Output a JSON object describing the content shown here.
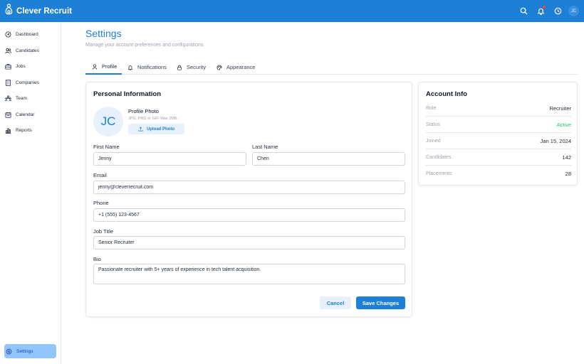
{
  "app": {
    "name": "Clever Recruit",
    "avatar_initials": "JC"
  },
  "header_icons": [
    "search-icon",
    "bell-icon",
    "clock-icon"
  ],
  "sidebar": {
    "items": [
      {
        "label": "Dashboard",
        "icon": "dashboard-icon"
      },
      {
        "label": "Candidates",
        "icon": "users-icon"
      },
      {
        "label": "Jobs",
        "icon": "briefcase-icon"
      },
      {
        "label": "Companies",
        "icon": "building-icon"
      },
      {
        "label": "Team",
        "icon": "team-icon"
      },
      {
        "label": "Calendar",
        "icon": "calendar-icon"
      },
      {
        "label": "Reports",
        "icon": "bar-chart-icon"
      }
    ],
    "settings_label": "Settings"
  },
  "page": {
    "title": "Settings",
    "subtitle": "Manage your account preferences and configurations."
  },
  "tabs": [
    {
      "label": "Profile",
      "icon": "user-icon",
      "active": true
    },
    {
      "label": "Notifications",
      "icon": "bell-icon",
      "active": false
    },
    {
      "label": "Security",
      "icon": "lock-icon",
      "active": false
    },
    {
      "label": "Appearance",
      "icon": "palette-icon",
      "active": false
    }
  ],
  "personal": {
    "title": "Personal Information",
    "avatar_initials": "JC",
    "photo_label": "Profile Photo",
    "photo_hint": "JPG, PNG or GIF. Max 2MB.",
    "upload_label": "Upload Photo",
    "first_name": {
      "label": "First Name",
      "value": "Jenny"
    },
    "last_name": {
      "label": "Last Name",
      "value": "Chen"
    },
    "email": {
      "label": "Email",
      "value": "jenny@cleverrecruit.com"
    },
    "phone": {
      "label": "Phone",
      "value": "+1 (555) 123-4567"
    },
    "job_title": {
      "label": "Job Title",
      "value": "Senior Recruiter"
    },
    "bio": {
      "label": "Bio",
      "value": "Passionate recruiter with 5+ years of experience in tech talent acquisition."
    },
    "cancel_label": "Cancel",
    "save_label": "Save Changes"
  },
  "account": {
    "title": "Account Info",
    "rows": [
      {
        "key": "Role",
        "value": "Recruiter"
      },
      {
        "key": "Status",
        "value": "Active"
      },
      {
        "key": "Joined",
        "value": "Jan 15, 2024"
      },
      {
        "key": "Candidates",
        "value": "142"
      },
      {
        "key": "Placements",
        "value": "28"
      }
    ]
  },
  "colors": {
    "primary": "#1d7fd6",
    "active_status": "#22c55e",
    "notification_dot": "#ef4444"
  }
}
